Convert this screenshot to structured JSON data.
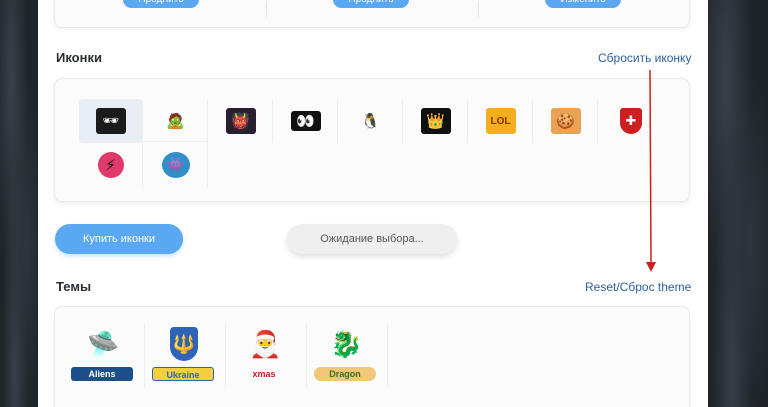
{
  "top_buttons": [
    "Продлить",
    "Продлить",
    "Изменить"
  ],
  "icons_section": {
    "title": "Иконки",
    "reset_link": "Сбросить иконку",
    "icons": [
      {
        "name": "matrix-neo-icon",
        "glyph": "🕶"
      },
      {
        "name": "zombie-fly-icon",
        "glyph": "🧟"
      },
      {
        "name": "dark-warrior-icon",
        "glyph": "👹"
      },
      {
        "name": "eyes-icon",
        "glyph": "👀"
      },
      {
        "name": "penguin-santa-icon",
        "glyph": "🐧"
      },
      {
        "name": "crown-icon",
        "glyph": "👑"
      },
      {
        "name": "lol-icon",
        "glyph": "LOL"
      },
      {
        "name": "cookie-cat-icon",
        "glyph": "🍪"
      },
      {
        "name": "shield-cross-icon",
        "glyph": "✚"
      },
      {
        "name": "lightning-badge-icon",
        "glyph": "⚡"
      },
      {
        "name": "blue-monster-icon",
        "glyph": "👾"
      }
    ]
  },
  "buy_icons_button": "Купить иконки",
  "waiting_button": "Ожидание выбора...",
  "themes_section": {
    "title": "Темы",
    "reset_link": "Reset/Сброс theme",
    "themes": [
      {
        "name": "theme-aliens",
        "label": "Aliens",
        "glyph": "🛸"
      },
      {
        "name": "theme-ukraine",
        "label": "Ukraine",
        "glyph": "🔱"
      },
      {
        "name": "theme-xmas",
        "label": "xmas",
        "glyph": "🎅"
      },
      {
        "name": "theme-dragon",
        "label": "Dragon",
        "glyph": "🐉"
      }
    ]
  },
  "colors": {
    "accent": "#5aa7f2",
    "link": "#2f5f9e",
    "arrow": "#cc1f1f"
  }
}
